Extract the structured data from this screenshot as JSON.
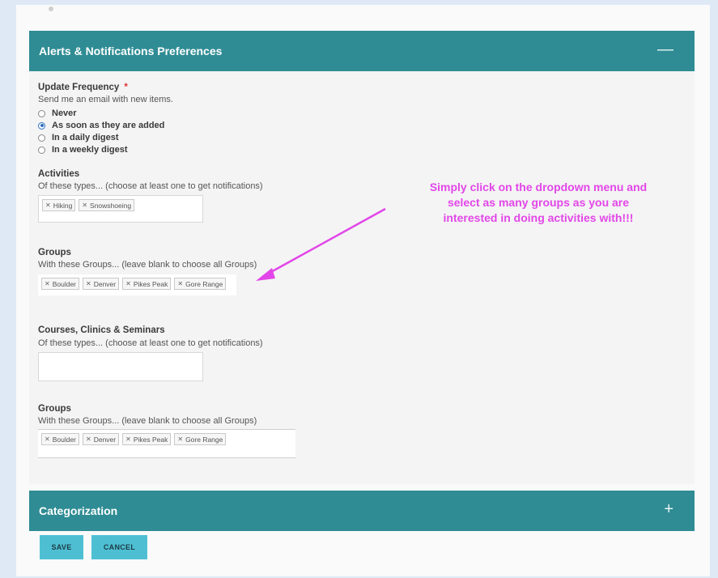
{
  "alerts_panel": {
    "title": "Alerts & Notifications Preferences",
    "toggle": "—"
  },
  "update_frequency": {
    "title": "Update Frequency",
    "required_marker": "*",
    "description": "Send me an email with new items.",
    "options": [
      {
        "label": "Never",
        "selected": false
      },
      {
        "label": "As soon as they are added",
        "selected": true
      },
      {
        "label": "In a daily digest",
        "selected": false
      },
      {
        "label": "In a weekly digest",
        "selected": false
      }
    ]
  },
  "activities": {
    "title": "Activities",
    "description": "Of these types... (choose at least one to get notifications)",
    "tags": [
      "Hiking",
      "Snowshoeing"
    ]
  },
  "groups_1": {
    "title": "Groups",
    "description": "With these Groups... (leave blank to choose all Groups)",
    "tags": [
      "Boulder",
      "Denver",
      "Pikes Peak",
      "Gore Range"
    ]
  },
  "courses": {
    "title": "Courses, Clinics & Seminars",
    "description": "Of these types... (choose at least one to get notifications)",
    "tags": []
  },
  "groups_2": {
    "title": "Groups",
    "description": "With these Groups... (leave blank to choose all Groups)",
    "tags": [
      "Boulder",
      "Denver",
      "Pikes Peak",
      "Gore Range"
    ]
  },
  "annotation": {
    "line1": "Simply click on the dropdown menu and",
    "line2": "select as many groups as you are",
    "line3": "interested in doing activities with!!!",
    "color": "#e246e8"
  },
  "categorization_panel": {
    "title": "Categorization",
    "toggle": "+"
  },
  "buttons": {
    "save": "SAVE",
    "cancel": "CANCEL"
  },
  "colors": {
    "header_teal": "#2f8c94",
    "button_blue": "#4ebfd3",
    "background": "#dfe8f5"
  }
}
